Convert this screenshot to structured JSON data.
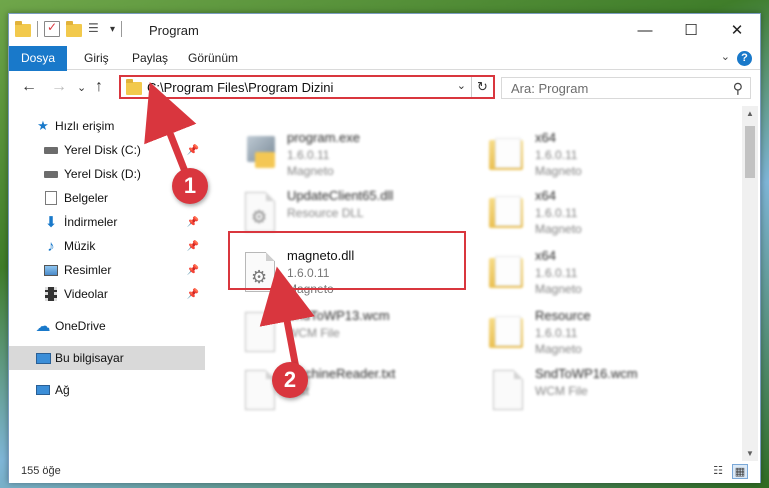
{
  "window": {
    "title": "Program",
    "controls": {
      "minimize": "—",
      "maximize": "☐",
      "close": "✕"
    }
  },
  "ribbon": {
    "tabs": [
      "Dosya",
      "Giriş",
      "Paylaş",
      "Görünüm"
    ],
    "expand": "⌄",
    "help": "?"
  },
  "nav": {
    "back": "←",
    "forward": "→",
    "recent": "⌄",
    "up": "↑",
    "address": "C:\\Program Files\\Program Dizini",
    "address_dropdown": "⌄",
    "refresh": "↻",
    "search_placeholder": "Ara: Program"
  },
  "sidebar": {
    "items": [
      {
        "label": "Hızlı erişim",
        "icon": "star-icon",
        "pinned": false
      },
      {
        "label": "Yerel Disk (C:)",
        "icon": "drive-icon",
        "pinned": true
      },
      {
        "label": "Yerel Disk (D:)",
        "icon": "drive-icon",
        "pinned": false
      },
      {
        "label": "Belgeler",
        "icon": "documents-icon",
        "pinned": false
      },
      {
        "label": "İndirmeler",
        "icon": "download-icon",
        "pinned": true
      },
      {
        "label": "Müzik",
        "icon": "music-icon",
        "pinned": true
      },
      {
        "label": "Resimler",
        "icon": "pictures-icon",
        "pinned": true
      },
      {
        "label": "Videolar",
        "icon": "videos-icon",
        "pinned": true
      },
      {
        "label": "OneDrive",
        "icon": "cloud-icon",
        "pinned": false
      },
      {
        "label": "Bu bilgisayar",
        "icon": "computer-icon",
        "pinned": false,
        "selected": true
      },
      {
        "label": "Ağ",
        "icon": "network-icon",
        "pinned": false
      }
    ]
  },
  "files": [
    {
      "name": "program.exe",
      "line2": "1.6.0.11",
      "line3": "Magneto",
      "type": "exe"
    },
    {
      "name": "x64",
      "line2": "1.6.0.11",
      "line3": "Magneto",
      "type": "folder"
    },
    {
      "name": "UpdateClient65.dll",
      "line2": "Resource DLL",
      "line3": "",
      "type": "dll"
    },
    {
      "name": "x64",
      "line2": "1.6.0.11",
      "line3": "Magneto",
      "type": "folder"
    },
    {
      "name": "magneto.dll",
      "line2": "1.6.0.11",
      "line3": "Magneto",
      "type": "dll",
      "highlighted": true
    },
    {
      "name": "x64",
      "line2": "1.6.0.11",
      "line3": "Magneto",
      "type": "folder"
    },
    {
      "name": "SndToWP13.wcm",
      "line2": "WCM File",
      "line3": "",
      "type": "doc"
    },
    {
      "name": "Resource",
      "line2": "1.6.0.11",
      "line3": "Magneto",
      "type": "folder"
    },
    {
      "name": "MachineReader.txt",
      "line2": "Text",
      "line3": "",
      "type": "doc"
    },
    {
      "name": "SndToWP16.wcm",
      "line2": "WCM File",
      "line3": "",
      "type": "doc"
    }
  ],
  "status": {
    "count": "155 öğe"
  },
  "annotations": {
    "callout_1": "1",
    "callout_2": "2"
  },
  "colors": {
    "accent": "#1979ca",
    "highlight": "#d9363e"
  }
}
